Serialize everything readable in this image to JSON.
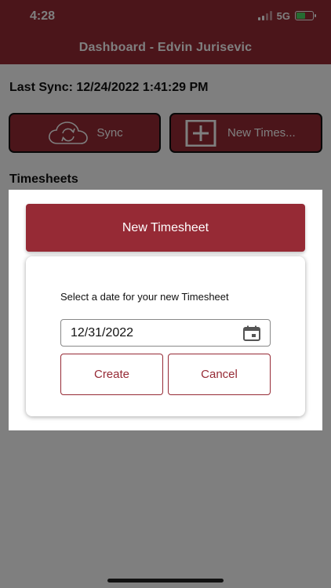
{
  "status_bar": {
    "time": "4:28",
    "network": "5G"
  },
  "header": {
    "title": "Dashboard - Edvin Jurisevic"
  },
  "sync_info": {
    "label": "Last Sync: 12/24/2022 1:41:29 PM"
  },
  "actions": {
    "sync_label": "Sync",
    "new_timesheet_label": "New Times..."
  },
  "section": {
    "title": "Timesheets"
  },
  "dialog": {
    "title": "New Timesheet",
    "prompt": "Select a date for your new Timesheet",
    "date_value": "12/31/2022",
    "create_label": "Create",
    "cancel_label": "Cancel"
  },
  "colors": {
    "brand": "#962a35",
    "overlay": "rgba(0,0,0,0.5)",
    "battery": "#4cd964"
  },
  "icons": {
    "sync": "cloud-sync-icon",
    "new_timesheet": "plus-box-icon",
    "date_picker": "calendar-icon"
  }
}
